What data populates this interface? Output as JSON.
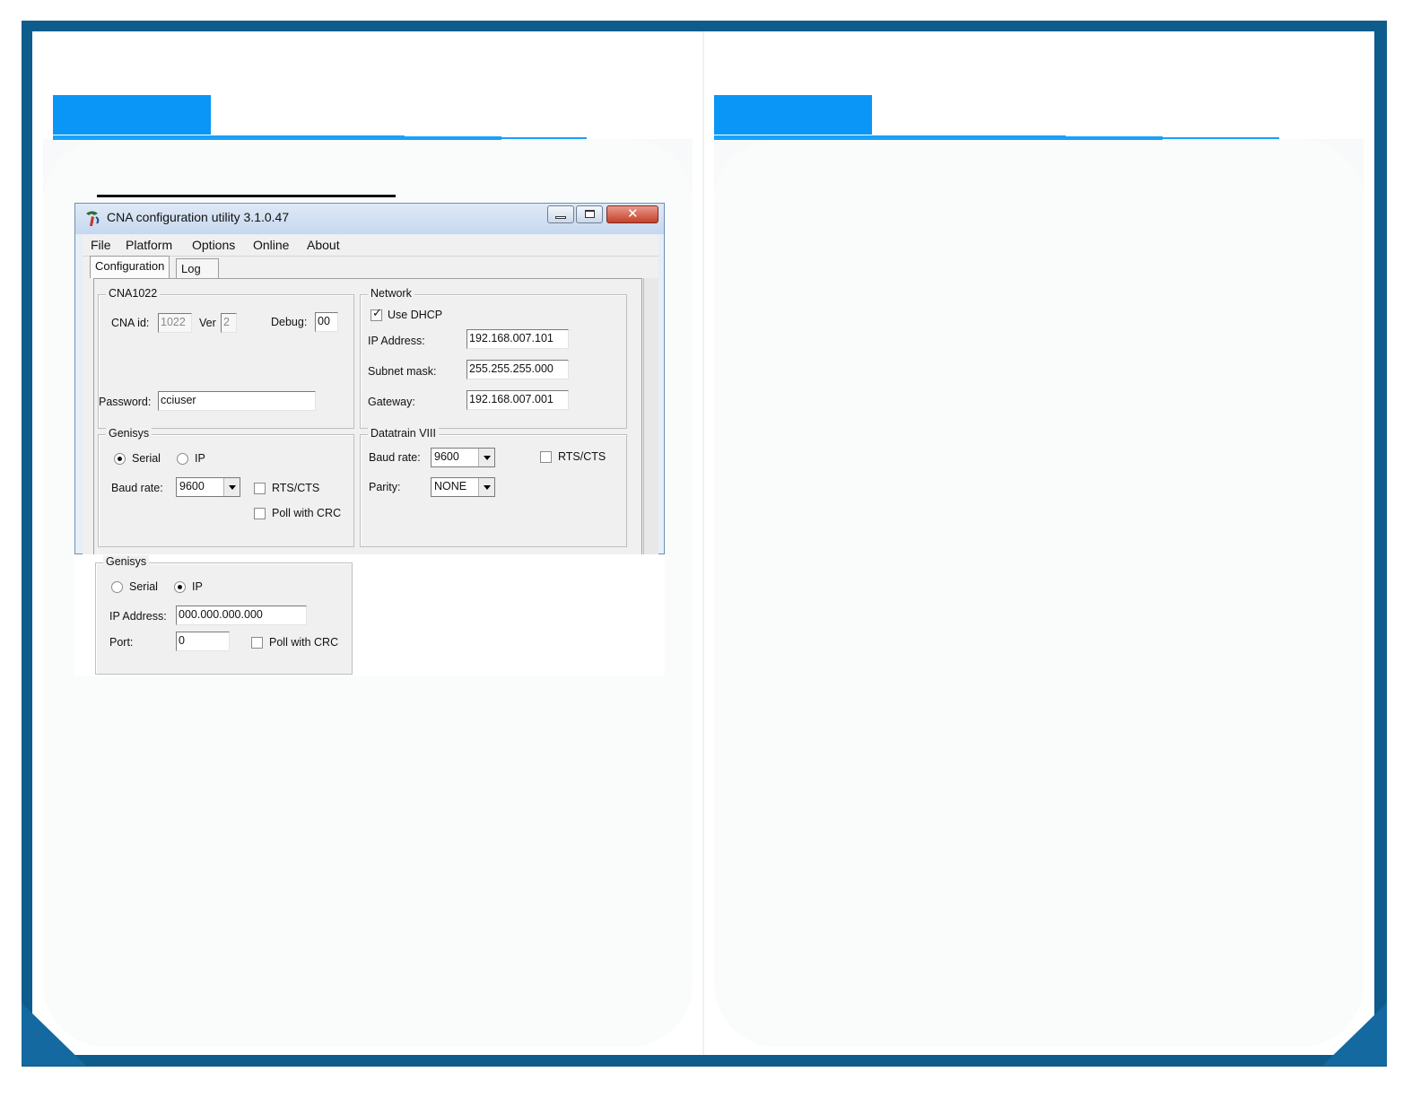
{
  "window": {
    "title": "CNA configuration utility 3.1.0.47",
    "menu": [
      "File",
      "Platform",
      "Options",
      "Online",
      "About"
    ],
    "tabs": [
      "Configuration",
      "Log"
    ]
  },
  "cna": {
    "group_label": "CNA1022",
    "cna_id_label": "CNA id:",
    "cna_id_value": "1022",
    "ver_label": "Ver",
    "ver_value": "2",
    "debug_label": "Debug:",
    "debug_value": "00",
    "password_label": "Password:",
    "password_value": "cciuser"
  },
  "network": {
    "group_label": "Network",
    "use_dhcp_label": "Use DHCP",
    "use_dhcp_checked": true,
    "ip_label": "IP Address:",
    "ip_value": "192.168.007.101",
    "subnet_label": "Subnet mask:",
    "subnet_value": "255.255.255.000",
    "gateway_label": "Gateway:",
    "gateway_value": "192.168.007.001"
  },
  "genisys_serial": {
    "group_label": "Genisys",
    "serial_label": "Serial",
    "ip_label": "IP",
    "selected": "Serial",
    "baud_label": "Baud rate:",
    "baud_value": "9600",
    "rtscts_label": "RTS/CTS",
    "poll_crc_label": "Poll with CRC"
  },
  "datatrain": {
    "group_label": "Datatrain VIII",
    "baud_label": "Baud rate:",
    "baud_value": "9600",
    "rtscts_label": "RTS/CTS",
    "parity_label": "Parity:",
    "parity_value": "NONE"
  },
  "genisys_ip": {
    "group_label": "Genisys",
    "serial_label": "Serial",
    "ip_label": "IP",
    "selected": "IP",
    "ip_address_label": "IP Address:",
    "ip_address_value": "000.000.000.000",
    "port_label": "Port:",
    "port_value": "0",
    "poll_crc_label": "Poll with CRC"
  },
  "colors": {
    "frame": "#0d5c8c",
    "header_block": "#0a96f6",
    "header_line": "#1aa0f8"
  }
}
